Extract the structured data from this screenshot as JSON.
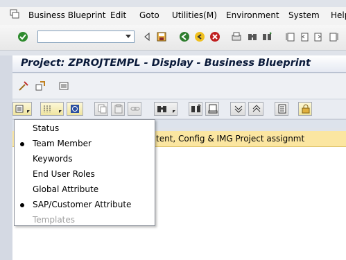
{
  "menubar": {
    "items": [
      "Business Blueprint",
      "Edit",
      "Goto",
      "Utilities(M)",
      "Environment",
      "System",
      "Help"
    ]
  },
  "toolbar": {
    "command_field": "",
    "icons": [
      "enter-icon",
      "save-icon",
      "back-icon",
      "exit-icon",
      "cancel-icon",
      "print-icon",
      "find-icon",
      "find-next-icon",
      "first-page-icon",
      "previous-page-icon",
      "next-page-icon",
      "last-page-icon"
    ]
  },
  "title": "Project: ZPROJTEMPL - Display - Business Blueprint",
  "content": {
    "banner_text": "tent, Config & IMG Project assignmt"
  },
  "popup_menu": {
    "items": [
      {
        "label": "Status",
        "checked": false,
        "disabled": false
      },
      {
        "label": "Team Member",
        "checked": true,
        "disabled": false
      },
      {
        "label": "Keywords",
        "checked": false,
        "disabled": false
      },
      {
        "label": "End User Roles",
        "checked": false,
        "disabled": false
      },
      {
        "label": "Global Attribute",
        "checked": false,
        "disabled": false
      },
      {
        "label": "SAP/Customer Attribute",
        "checked": true,
        "disabled": false
      },
      {
        "label": "Templates",
        "checked": false,
        "disabled": true
      }
    ]
  },
  "colors": {
    "title_text": "#0a1a3a",
    "banner": "#fbe6a1",
    "button_yellow": "#efe4a0"
  }
}
